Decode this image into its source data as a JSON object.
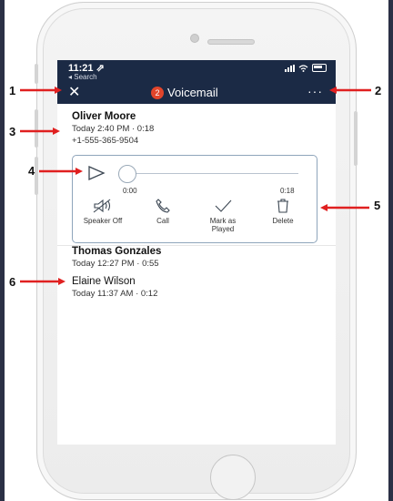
{
  "status_bar": {
    "time": "11:21 ⇗",
    "back_label": "◂ Search"
  },
  "header": {
    "title": "Voicemail",
    "badge_count": "2",
    "more": "···"
  },
  "voicemails": [
    {
      "name": "Oliver Moore",
      "meta": "Today 2:40 PM · 0:18",
      "number": "+1-555-365-9504"
    },
    {
      "name": "Thomas Gonzales",
      "meta": "Today 12:27 PM · 0:55"
    },
    {
      "name": "Elaine Wilson",
      "meta": "Today 11:37 AM · 0:12"
    }
  ],
  "player": {
    "position": "0:00",
    "duration": "0:18",
    "progress": 0
  },
  "actions": {
    "speaker": "Speaker Off",
    "call": "Call",
    "mark": "Mark as Played",
    "delete": "Delete"
  },
  "annotations": [
    "1",
    "2",
    "3",
    "4",
    "5",
    "6"
  ],
  "colors": {
    "header_bg": "#1b2a45",
    "badge": "#e2452b",
    "arrow": "#e02020",
    "player_border": "#8fa5bb"
  }
}
